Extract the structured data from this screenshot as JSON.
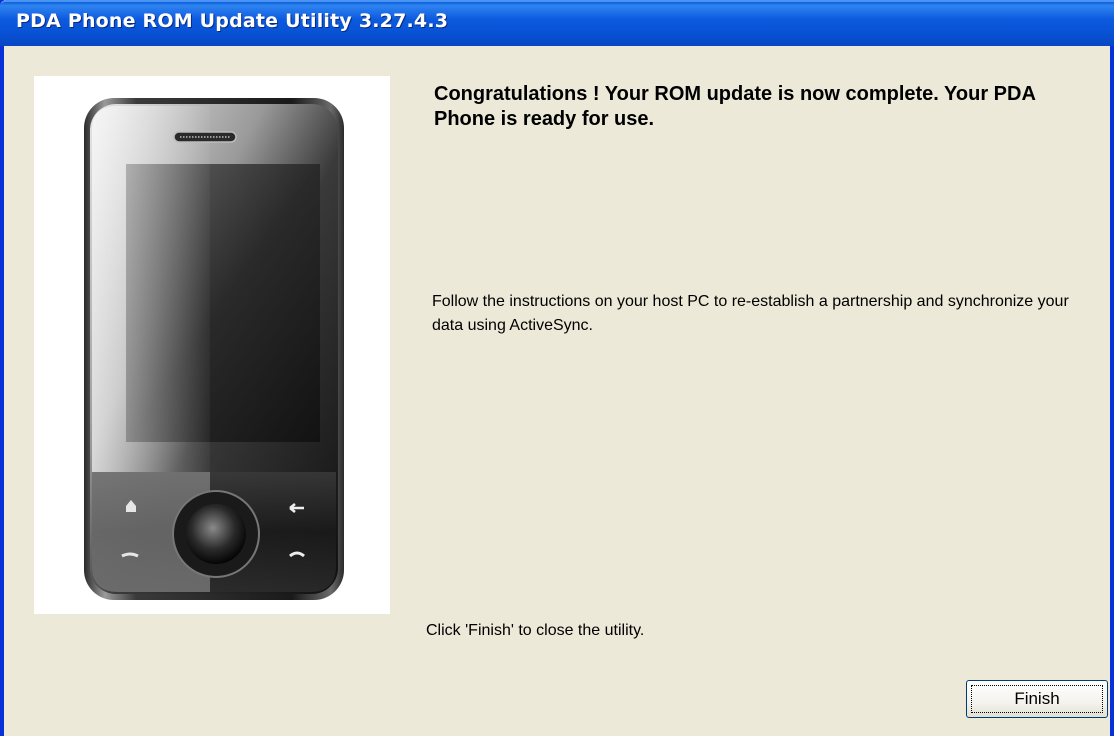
{
  "window": {
    "title": "PDA Phone ROM Update Utility 3.27.4.3"
  },
  "content": {
    "headline": "Congratulations ! Your ROM update is now complete. Your PDA Phone is ready for use.",
    "instructions": "Follow the instructions on your host PC to re-establish a partnership and synchronize your data using ActiveSync.",
    "finish_hint": "Click 'Finish' to close the utility."
  },
  "buttons": {
    "finish_label": "Finish"
  },
  "image": {
    "subject": "pda-phone-illustration"
  },
  "colors": {
    "titlebar": "#0852d4",
    "dialog_background": "#ece9d8",
    "border": "#0831d9"
  }
}
